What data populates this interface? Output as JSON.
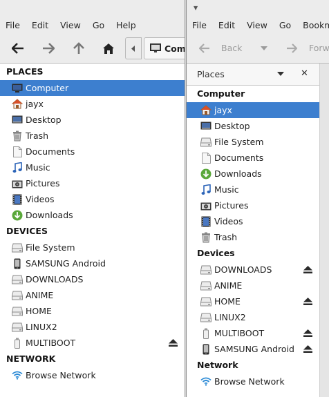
{
  "left_window": {
    "menu": [
      "File",
      "Edit",
      "View",
      "Go",
      "Help"
    ],
    "path_button": "Computer",
    "places_header": "PLACES",
    "places": [
      "Computer",
      "jayx",
      "Desktop",
      "Trash",
      "Documents",
      "Music",
      "Pictures",
      "Videos",
      "Downloads"
    ],
    "devices_header": "DEVICES",
    "devices": [
      "File System",
      "SAMSUNG Android",
      "DOWNLOADS",
      "ANIME",
      "HOME",
      "LINUX2",
      "MULTIBOOT"
    ],
    "network_header": "NETWORK",
    "network": [
      "Browse Network"
    ]
  },
  "right_window": {
    "menu": [
      "File",
      "Edit",
      "View",
      "Go",
      "Bookmarks"
    ],
    "back_label": "Back",
    "forward_label": "Forward",
    "panel_title": "Places",
    "computer_header": "Computer",
    "computer": [
      "jayx",
      "Desktop",
      "File System",
      "Documents",
      "Downloads",
      "Music",
      "Pictures",
      "Videos",
      "Trash"
    ],
    "devices_header": "Devices",
    "devices": [
      "DOWNLOADS",
      "ANIME",
      "HOME",
      "LINUX2",
      "MULTIBOOT",
      "SAMSUNG Android"
    ],
    "network_header": "Network",
    "network": [
      "Browse Network"
    ]
  },
  "colors": {
    "selection": "#3d7fcf",
    "toolbar": "#ececec"
  }
}
